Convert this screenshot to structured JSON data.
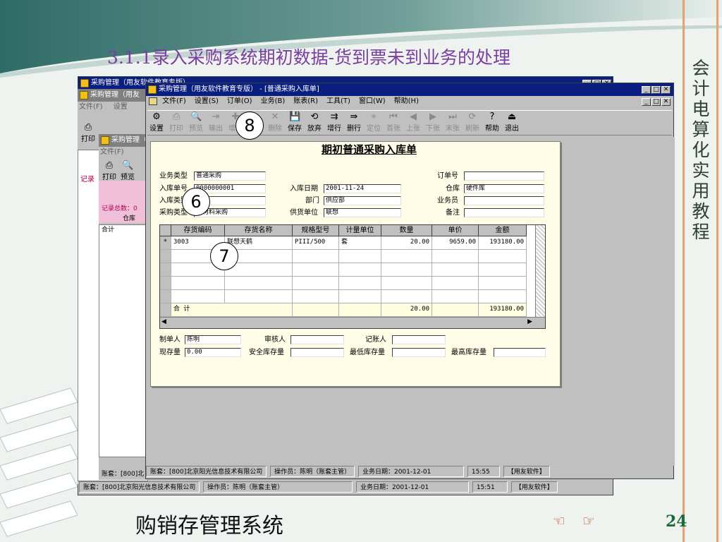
{
  "slide": {
    "title": "3.1.1录入采购系统期初数据-货到票未到业务的处理",
    "side_title": "会计电算化实用教程",
    "bottom_title": "购销存管理系统",
    "page_number": "24"
  },
  "colors": {
    "title": "#7b3fa0",
    "titlebar": "#0a1e80",
    "form_bg": "#fffde8",
    "accent": "#1a6b3a"
  },
  "background": {
    "win1_title": "采购管理（用友软件教育专版）",
    "win2_title": "采购管理（用友",
    "win3_title": "采购管理（",
    "menu_file": "文件(F)",
    "menu_set": "设置",
    "tool_print": "打印",
    "tool_preview": "预览",
    "tool_output": "输",
    "records_label": "记录总数：0",
    "side_label": "记录",
    "warehouse_col": "仓库",
    "total_label": "合计",
    "status_left": "账套：[800]北"
  },
  "window": {
    "title": "采购管理（用友软件教育专版） - [普通采购入库单]",
    "menu": [
      "文件(F)",
      "设置(S)",
      "订单(O)",
      "业务(B)",
      "账表(R)",
      "工具(T)",
      "窗口(W)",
      "帮助(H)"
    ],
    "toolbar": [
      {
        "label": "设置",
        "icon": "⚙",
        "enabled": true
      },
      {
        "label": "打印",
        "icon": "⎙",
        "enabled": false
      },
      {
        "label": "预览",
        "icon": "🔍",
        "enabled": false
      },
      {
        "label": "输出",
        "icon": "⇥",
        "enabled": false
      },
      {
        "label": "增加",
        "icon": "✚",
        "enabled": false
      },
      {
        "label": "修改",
        "icon": "✎",
        "enabled": false
      },
      {
        "label": "删除",
        "icon": "✕",
        "enabled": false
      },
      {
        "label": "保存",
        "icon": "💾",
        "enabled": true
      },
      {
        "label": "放弃",
        "icon": "⟲",
        "enabled": true
      },
      {
        "label": "增行",
        "icon": "⇉",
        "enabled": true
      },
      {
        "label": "删行",
        "icon": "⇛",
        "enabled": true
      },
      {
        "label": "定位",
        "icon": "⌖",
        "enabled": false
      },
      {
        "label": "首张",
        "icon": "⏮",
        "enabled": false
      },
      {
        "label": "上张",
        "icon": "◀",
        "enabled": false
      },
      {
        "label": "下张",
        "icon": "▶",
        "enabled": false
      },
      {
        "label": "末张",
        "icon": "⏭",
        "enabled": false
      },
      {
        "label": "刷新",
        "icon": "⟳",
        "enabled": false
      },
      {
        "label": "帮助",
        "icon": "?",
        "enabled": true
      },
      {
        "label": "退出",
        "icon": "⏏",
        "enabled": true
      }
    ]
  },
  "form": {
    "title": "期初普通采购入库单",
    "fields": {
      "biz_type_label": "业务类型",
      "biz_type": "普通采购",
      "in_no_label": "入库单号",
      "in_no": "0000000001",
      "in_type_label": "入库类别",
      "in_type": "入库",
      "pur_type_label": "采购类型",
      "pur_type": "原材料采购",
      "in_date_label": "入库日期",
      "in_date": "2001-11-24",
      "dept_label": "部门",
      "dept": "供应部",
      "supplier_label": "供货单位",
      "supplier": "联想",
      "order_no_label": "订单号",
      "order_no": "",
      "warehouse_label": "仓库",
      "warehouse": "硬件库",
      "clerk_label": "业务员",
      "clerk": "",
      "memo_label": "备注",
      "memo": ""
    },
    "columns": [
      "存货编码",
      "存货名称",
      "规格型号",
      "计量单位",
      "数量",
      "单价",
      "金额"
    ],
    "rows": [
      {
        "marker": "*",
        "code": "3003",
        "name": "联想天鹤",
        "spec": "PIII/500",
        "unit": "套",
        "qty": "20.00",
        "price": "9659.00",
        "amount": "193180.00"
      }
    ],
    "total": {
      "label": "合  计",
      "qty": "20.00",
      "amount": "193180.00"
    },
    "footer": {
      "maker_label": "制单人",
      "maker": "陈明",
      "auditor_label": "审核人",
      "auditor": "",
      "bookkeeper_label": "记账人",
      "bookkeeper": "",
      "stock_label": "现存量",
      "stock": "0.00",
      "safe_label": "安全库存量",
      "safe": "",
      "min_label": "最低库存量",
      "min": "",
      "max_label": "最高库存量",
      "max": ""
    }
  },
  "status_front": {
    "account": "账套：[800]北京阳光信息技术有限公司",
    "operator": "操作员：陈明（账套主管）",
    "date": "业务日期：2001-12-01",
    "time": "15:55",
    "brand": "【用友软件】"
  },
  "status_back": {
    "account": "账套：[800]北京阳光信息技术有限公司",
    "operator": "操作员：陈明（账套主管）",
    "date": "业务日期：2001-12-01",
    "time": "15:51",
    "brand": "【用友软件】"
  },
  "callouts": [
    "8",
    "6",
    "7"
  ]
}
